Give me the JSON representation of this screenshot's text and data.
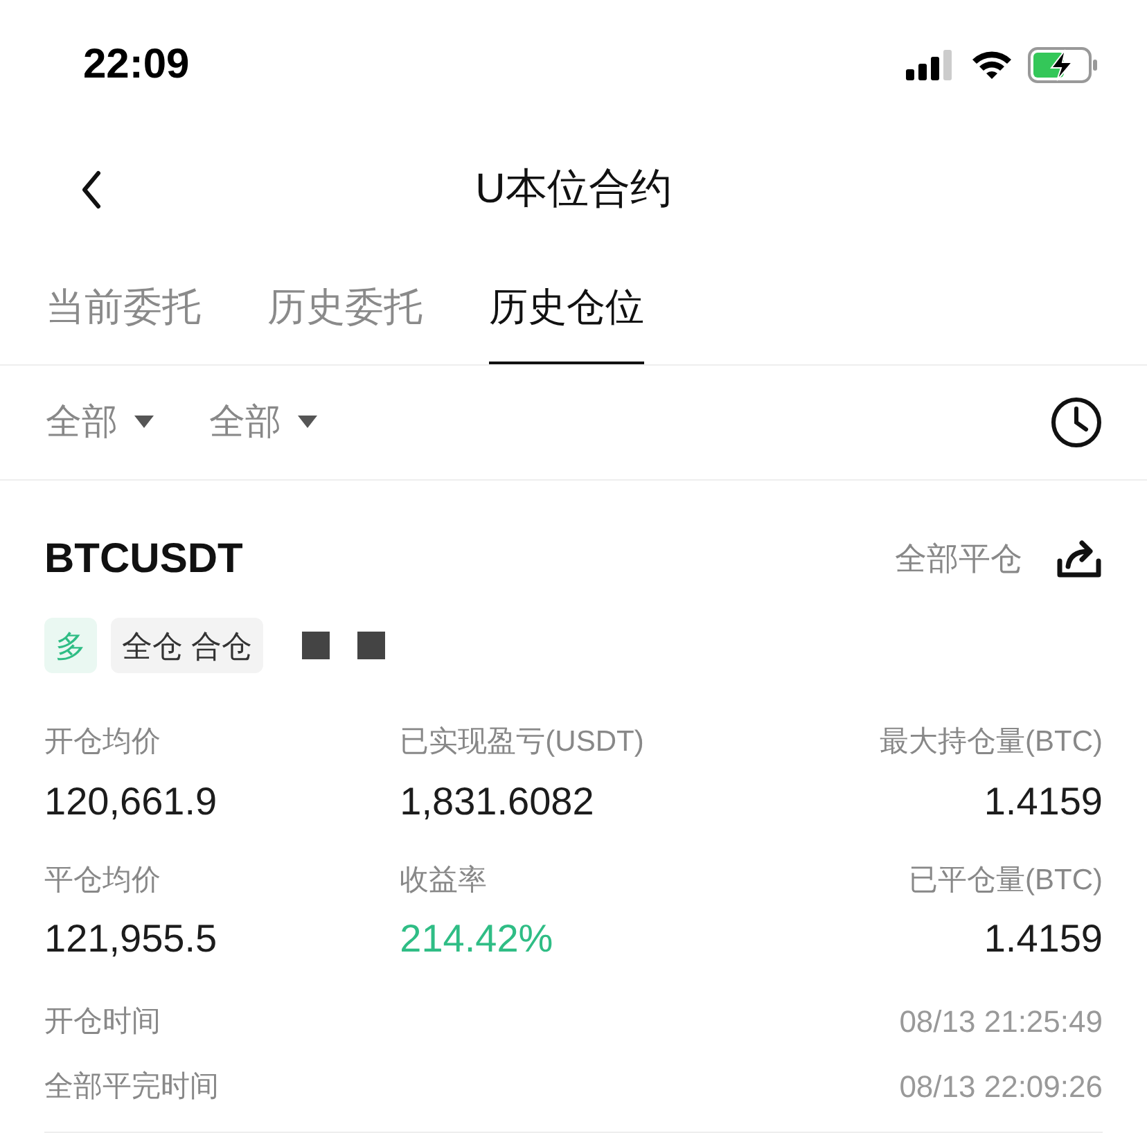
{
  "status_bar": {
    "time": "22:09"
  },
  "header": {
    "title": "U本位合约"
  },
  "tabs": [
    {
      "label": "当前委托",
      "selected": false
    },
    {
      "label": "历史委托",
      "selected": false
    },
    {
      "label": "历史仓位",
      "selected": true
    }
  ],
  "filters": [
    {
      "label": "全部"
    },
    {
      "label": "全部"
    }
  ],
  "position": {
    "symbol": "BTCUSDT",
    "action": "全部平仓",
    "tags": [
      {
        "label": "多",
        "kind": "side"
      },
      {
        "label": "全仓 合仓",
        "kind": "mode"
      }
    ],
    "stats": [
      {
        "label": "开仓均价",
        "value": "120,661.9",
        "kind": "plain"
      },
      {
        "label": "已实现盈亏(USDT)",
        "value": "1,831.6082",
        "kind": "plain"
      },
      {
        "label": "最大持仓量(BTC)",
        "value": "1.4159",
        "kind": "plain"
      },
      {
        "label": "平仓均价",
        "value": "121,955.5",
        "kind": "plain"
      },
      {
        "label": "收益率",
        "value": "214.42%",
        "kind": "gain"
      },
      {
        "label": "已平仓量(BTC)",
        "value": "1.4159",
        "kind": "plain"
      }
    ],
    "times": [
      {
        "label": "开仓时间",
        "value": "08/13 21:25:49"
      },
      {
        "label": "全部平完时间",
        "value": "08/13 22:09:26"
      }
    ]
  }
}
